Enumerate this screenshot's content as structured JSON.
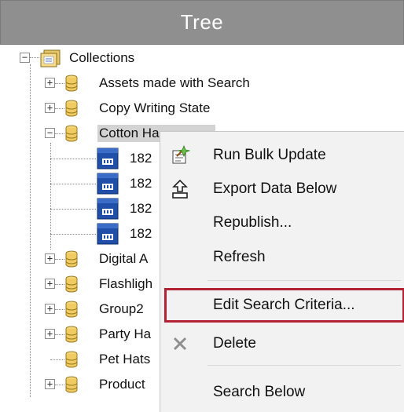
{
  "header": {
    "title": "Tree"
  },
  "tree": {
    "root": {
      "label": "Collections",
      "expanded": true
    },
    "items": [
      {
        "label": "Assets made with Search",
        "expander": "+"
      },
      {
        "label": "Copy Writing State",
        "expander": "+"
      },
      {
        "label": "Cotton Ha",
        "expander": "-",
        "selected": true
      },
      {
        "label": "182"
      },
      {
        "label": "182"
      },
      {
        "label": "182"
      },
      {
        "label": "182"
      },
      {
        "label": "Digital A",
        "expander": "+"
      },
      {
        "label": "Flashligh",
        "expander": "+"
      },
      {
        "label": "Group2",
        "expander": "+"
      },
      {
        "label": "Party Ha",
        "expander": "+"
      },
      {
        "label": "Pet Hats"
      },
      {
        "label": "Product",
        "expander": "+"
      }
    ]
  },
  "context_menu": {
    "items": [
      {
        "label": "Run Bulk Update",
        "icon": "bulk-update-icon"
      },
      {
        "label": "Export Data Below",
        "icon": "export-icon"
      },
      {
        "label": "Republish..."
      },
      {
        "label": "Refresh"
      },
      {
        "label": "Edit Search Criteria...",
        "highlighted": true
      },
      {
        "label": "Delete",
        "icon": "delete-x-icon"
      },
      {
        "label": "Search Below"
      }
    ],
    "highlight_color": "#b22234"
  },
  "colors": {
    "header_bg": "#8f8f8f",
    "menu_bg": "#f2f2f2",
    "selection_bg": "#d3d3d3",
    "cube_blue": "#1f4fa8"
  }
}
